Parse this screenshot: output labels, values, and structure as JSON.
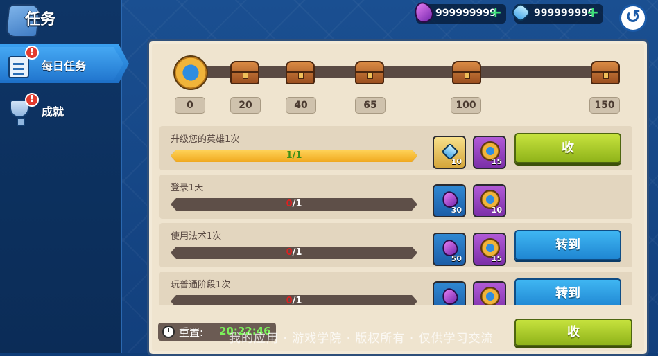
{
  "title": "任务",
  "sidebar": {
    "tabs": [
      {
        "label": "每日任务",
        "badge": "!"
      },
      {
        "label": "成就",
        "badge": "!"
      }
    ]
  },
  "currency": {
    "purple_gems": "999999999",
    "blue_gems": "999999999",
    "plus": "+"
  },
  "back_icon": "↺",
  "milestones": [
    "0",
    "20",
    "40",
    "65",
    "100",
    "150"
  ],
  "tasks": [
    {
      "name": "升级您的英雄1次",
      "progress_current": "1",
      "progress_total": "/1",
      "progress_fraction": 1.0,
      "rewards": [
        {
          "type": "blue-gem",
          "qty": "10"
        },
        {
          "type": "medal",
          "qty": "15"
        }
      ],
      "button": "收"
    },
    {
      "name": "登录1天",
      "progress_current": "0",
      "progress_total": "/1",
      "progress_fraction": 0.0,
      "rewards": [
        {
          "type": "purple-gem",
          "qty": "30"
        },
        {
          "type": "medal",
          "qty": "10"
        }
      ],
      "button": ""
    },
    {
      "name": "使用法术1次",
      "progress_current": "0",
      "progress_total": "/1",
      "progress_fraction": 0.0,
      "rewards": [
        {
          "type": "purple-gem",
          "qty": "50"
        },
        {
          "type": "medal",
          "qty": "15"
        }
      ],
      "button": "转到"
    },
    {
      "name": "玩普通阶段1次",
      "progress_current": "0",
      "progress_total": "/1",
      "progress_fraction": 0.0,
      "rewards": [
        {
          "type": "purple-gem",
          "qty": ""
        },
        {
          "type": "medal",
          "qty": ""
        }
      ],
      "button": "转到"
    }
  ],
  "reset": {
    "label": "重置:",
    "time": "20:22:46"
  },
  "collect_all": "收",
  "watermark": "我的应用 · 游戏学院 · 版权所有 · 仅供学习交流"
}
